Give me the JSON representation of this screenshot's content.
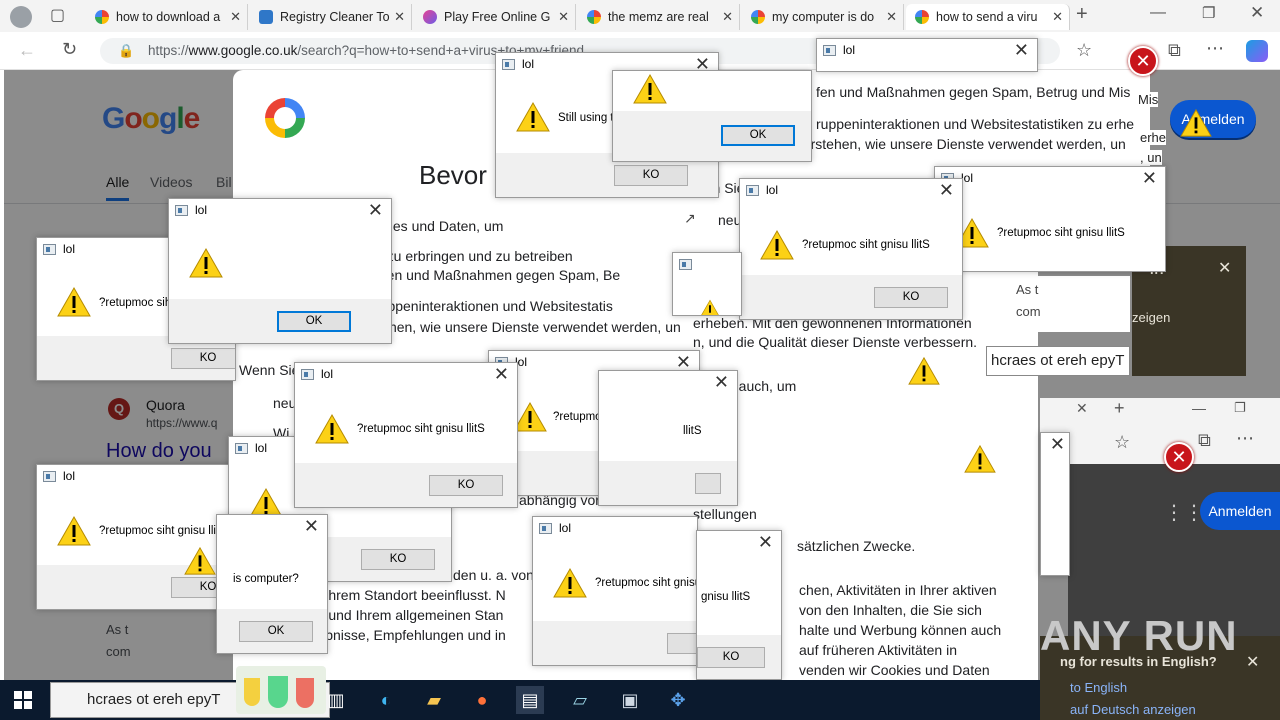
{
  "browser": {
    "tabs": [
      {
        "label": "how to download a"
      },
      {
        "label": "Registry Cleaner To"
      },
      {
        "label": "Play Free Online G"
      },
      {
        "label": "the memz are real"
      },
      {
        "label": "my computer is do"
      },
      {
        "label": "how to send a viru"
      }
    ],
    "url_prefix": "https://",
    "url_host": "www.google.co.uk",
    "url_path": "/search?q=how+to+send+a+virus+to+my+friend",
    "new_tab": "+",
    "back_icon": "back-arrow-icon",
    "reload_icon": "reload-icon"
  },
  "google": {
    "logo": "Google",
    "tabs": [
      "Alle",
      "Videos",
      "Bil"
    ],
    "anmelden": "Anmelden",
    "quora_name": "Quora",
    "quora_url": "https://www.q",
    "quora_title": "How do you",
    "side_text_1": "As t",
    "side_text_2": "com"
  },
  "consent": {
    "title": "Bevor",
    "lines": [
      "okies und Daten, um",
      "e zu erbringen und zu betreiben",
      "ufen und Maßnahmen gegen Spam, Be",
      "ruppeninteraktionen und Websitestatis",
      "möchten im Verstehen, wie unsere Dienste verwendet werden, un",
      "Wenn Sie",
      "neu",
      "Wi",
      "erheben. Mit den gewonnenen Informationen",
      "n, und die Qualität dieser Dienste verbessern.",
      "n auch, um",
      "abhängig von Ihren Einstell",
      "stellungen",
      "sätzlichen Zwecke.",
      "den u. a. von",
      "nd Ihrem Standort beeinflusst. N",
      "en, und Ihrem allgemeinen Stan",
      "rgebnisse, Empfehlungen und in",
      "chen, Aktivitäten in Ihrer aktiven",
      "von den Inhalten, die Sie sich",
      "halte und Werbung können auch",
      "auf früheren Aktivitäten in",
      "venden wir Cookies und Daten",
      "fen und Maßnahmen gegen Spam, Betrug und Mis",
      "ruppeninteraktionen und Websitestatistiken zu erhe",
      "möchten im Verstehen, wie unsere Dienste verwendet werden, un",
      "Wenn Sie",
      "neu"
    ]
  },
  "dialogs": {
    "title": "lol",
    "msg_reversed": "?retupmoc siht gnisu llitS",
    "msg_still": "Still using t",
    "msg_is_computer": "is computer?",
    "ok": "OK",
    "ko": "KO",
    "reversed_fragment": "?retupmoc siht",
    "frag_short": "?retupmoc siht gnisu llitS",
    "frag_gnisu": "gnisu llitS",
    "frag_llits": "llitS"
  },
  "popup_right": {
    "type_search": "hcraes ot ereh epyT",
    "english_q": "ng for results in English?",
    "to_english": "to English",
    "auf_deutsch": "auf Deutsch anzeigen",
    "h_q": "h?",
    "zeigen": "zeigen",
    "as_t": "As t",
    "com": "com",
    "mis": "Mis",
    "erhe": "erhe",
    "un": ", un"
  },
  "taskbar": {
    "search_text": "hcraes ot ereh epyT"
  },
  "watermark": "ANY RUN",
  "colors": {
    "ok_focus": "#0078d7",
    "google_blue": "#1a0dab",
    "anmelden_bg": "#0b57d0"
  }
}
